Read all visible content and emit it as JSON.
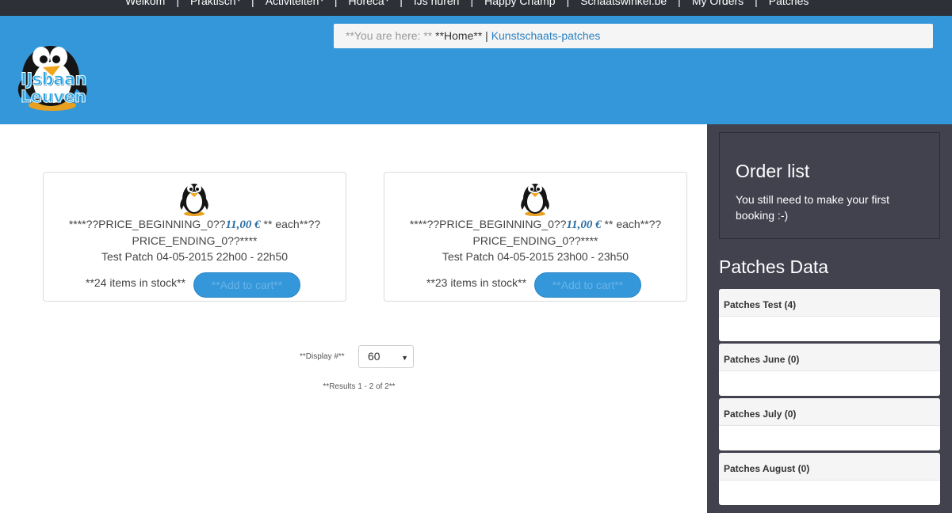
{
  "nav": {
    "items": [
      {
        "label": "Welkom"
      },
      {
        "label": "Praktisch",
        "caret": "▾"
      },
      {
        "label": "Activiteiten",
        "caret": "▾"
      },
      {
        "label": "Horeca",
        "caret": "▾"
      },
      {
        "label": "IJs huren"
      },
      {
        "label": "Happy Champ"
      },
      {
        "label": "Schaatswinkel.be"
      },
      {
        "label": "My Orders"
      },
      {
        "label": "Patches"
      }
    ],
    "separator": "|"
  },
  "logo": {
    "line1": "IJsbaan",
    "line2": "Leuven"
  },
  "breadcrumb": {
    "prefix": "**You are here: **",
    "home": "**Home**",
    "separator": " | ",
    "current": "Kunstschaats-patches"
  },
  "products": [
    {
      "price_prefix": "****??PRICE_BEGINNING_0??",
      "price": "11,00 €",
      "price_suffix": " ** each**??",
      "price_line2": "PRICE_ENDING_0??****",
      "title": "Test Patch 04-05-2015 22h00 - 22h50",
      "stock": "**24 items in stock**",
      "cart_label": "**Add to cart**"
    },
    {
      "price_prefix": "****??PRICE_BEGINNING_0??",
      "price": "11,00 €",
      "price_suffix": " ** each**??",
      "price_line2": "PRICE_ENDING_0??****",
      "title": "Test Patch 04-05-2015 23h00 - 23h50",
      "stock": "**23 items in stock**",
      "cart_label": "**Add to cart**"
    }
  ],
  "pagination": {
    "display_label": "**Display #**",
    "display_value": "60",
    "results": "**Results 1 - 2 of 2**"
  },
  "sidebar": {
    "order_title": "Order list",
    "order_text": "You still need to make your first booking :-)",
    "patches_title": "Patches Data",
    "patch_groups": [
      {
        "label": "Patches Test (4)"
      },
      {
        "label": "Patches June (0)"
      },
      {
        "label": "Patches July (0)"
      },
      {
        "label": "Patches August (0)"
      }
    ]
  },
  "colors": {
    "header": "#3497da",
    "topnav": "#2d3036",
    "sidebar": "#42424f",
    "price": "#2a6fa3"
  }
}
